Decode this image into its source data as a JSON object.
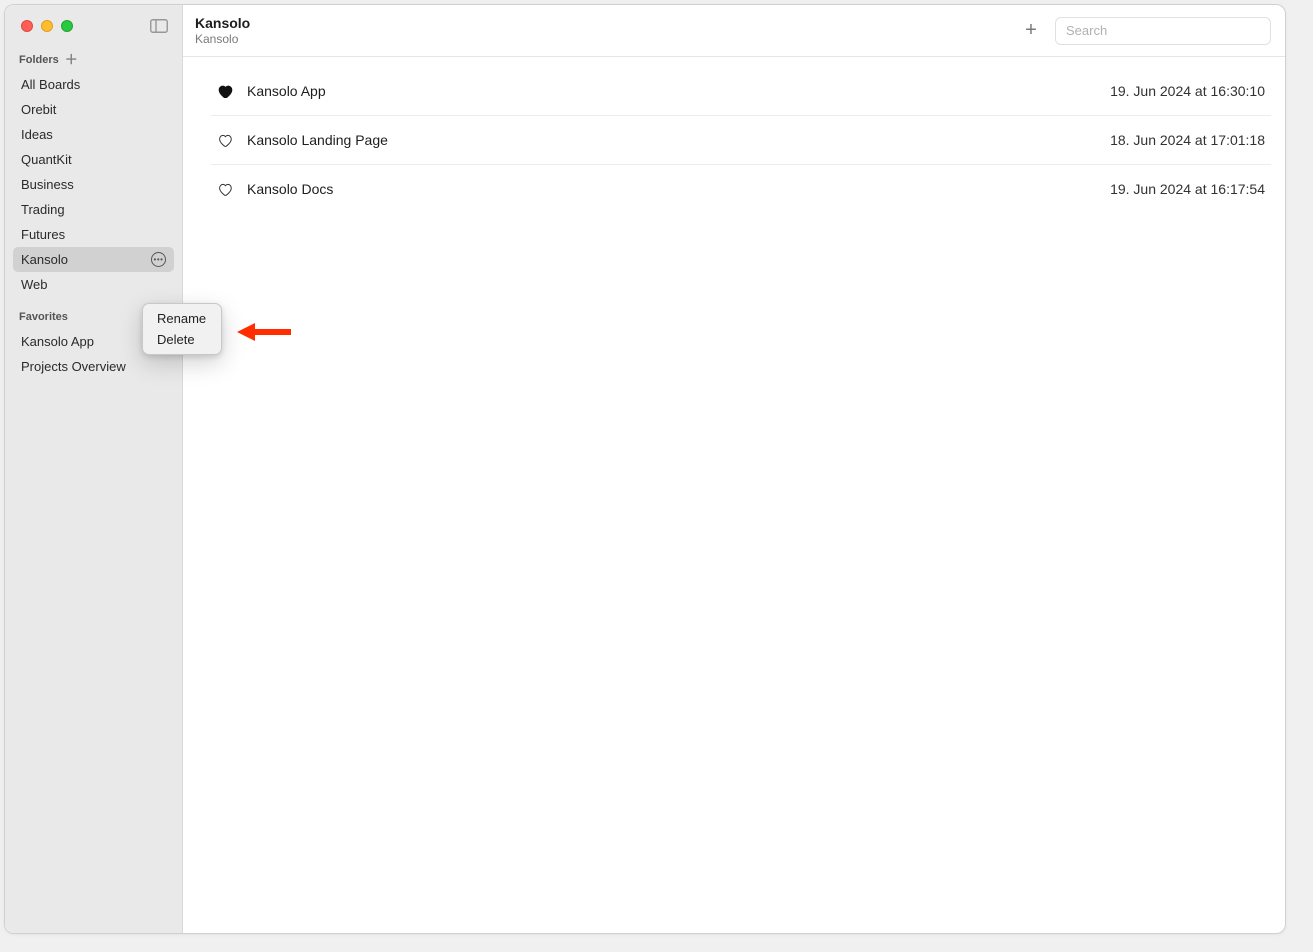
{
  "sidebar": {
    "sections": {
      "folders_label": "Folders",
      "favorites_label": "Favorites"
    },
    "folders": [
      {
        "label": "All Boards"
      },
      {
        "label": "Orebit"
      },
      {
        "label": "Ideas"
      },
      {
        "label": "QuantKit"
      },
      {
        "label": "Business"
      },
      {
        "label": "Trading"
      },
      {
        "label": "Futures"
      },
      {
        "label": "Kansolo",
        "selected": true
      },
      {
        "label": "Web"
      }
    ],
    "favorites": [
      {
        "label": "Kansolo App"
      },
      {
        "label": "Projects Overview"
      }
    ]
  },
  "context_menu": {
    "rename": "Rename",
    "delete": "Delete"
  },
  "header": {
    "title": "Kansolo",
    "subtitle": "Kansolo",
    "search_placeholder": "Search"
  },
  "boards": [
    {
      "title": "Kansolo App",
      "date": "19. Jun 2024 at 16:30:10",
      "favorited": true
    },
    {
      "title": "Kansolo Landing Page",
      "date": "18. Jun 2024 at 17:01:18",
      "favorited": false
    },
    {
      "title": "Kansolo Docs",
      "date": "19. Jun 2024 at 16:17:54",
      "favorited": false
    }
  ]
}
